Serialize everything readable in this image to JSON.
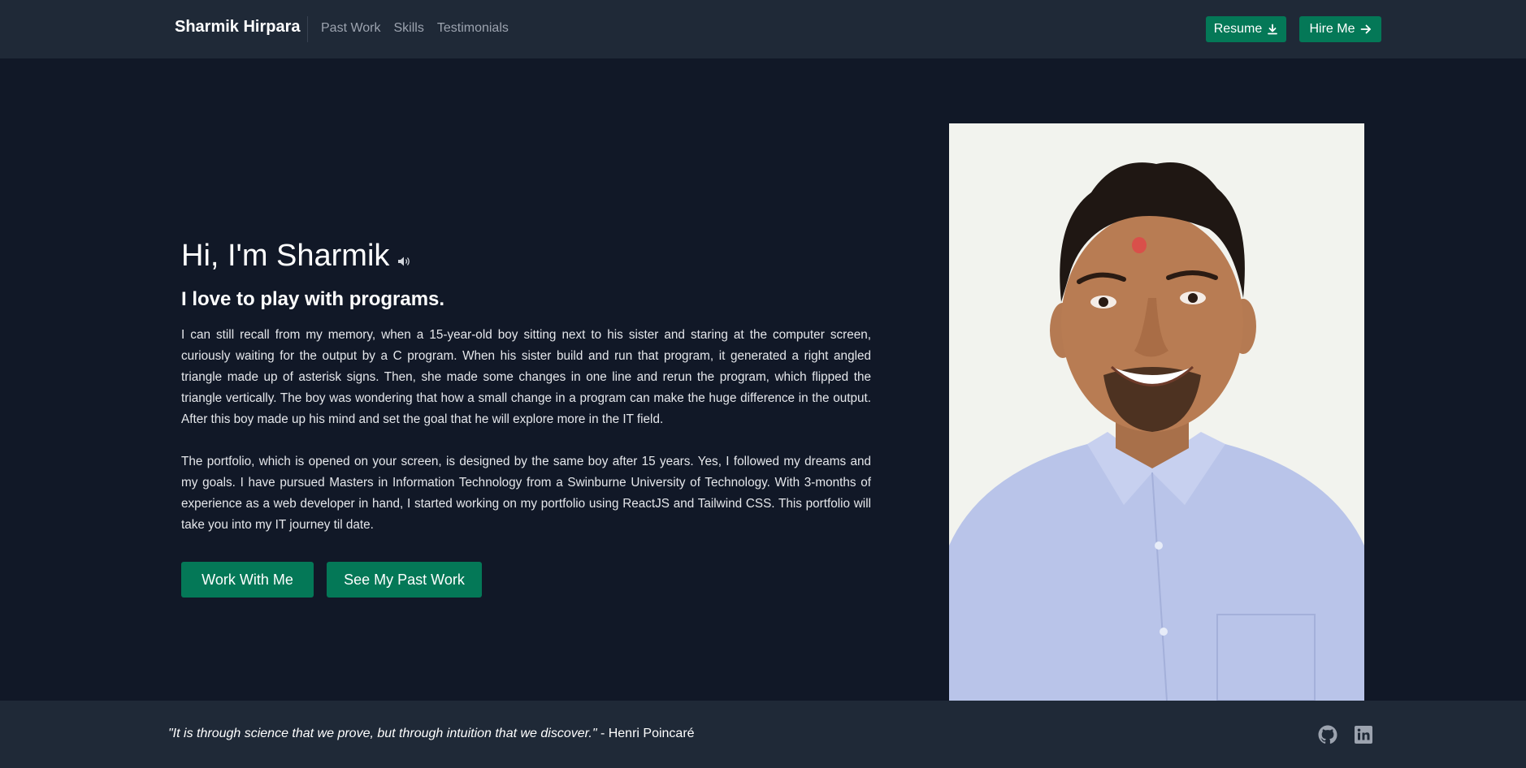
{
  "navbar": {
    "brand": "Sharmik Hirpara",
    "links": [
      "Past Work",
      "Skills",
      "Testimonials"
    ],
    "resume_label": "Resume",
    "hire_label": "Hire Me",
    "icons": {
      "resume": "download-icon",
      "hire": "arrow-right-icon"
    }
  },
  "hero": {
    "title": "Hi, I'm Sharmik",
    "title_icon": "speaker-icon",
    "subtitle": "I love to play with programs.",
    "paragraphs": [
      "I can still recall from my memory, when a 15-year-old boy sitting next to his sister and staring at the computer screen, curiously waiting for the output by a C program. When his sister build and run that program, it generated a right angled triangle made up of asterisk signs. Then, she made some changes in one line and rerun the program, which flipped the triangle vertically. The boy was wondering that how a small change in a program can make the huge difference in the output. After this boy made up his mind and set the goal that he will explore more in the IT field.",
      "The portfolio, which is opened on your screen, is designed by the same boy after 15 years. Yes, I followed my dreams and my goals. I have pursued Masters in Information Technology from a Swinburne University of Technology. With 3-months of experience as a web developer in hand, I started working on my portfolio using ReactJS and Tailwind CSS. This portfolio will take you into my IT journey til date."
    ],
    "buttons": [
      "Work With Me",
      "See My Past Work"
    ]
  },
  "footer": {
    "quote": "\"It is through science that we prove, but through intuition that we discover.\"",
    "author": " - Henri Poincaré",
    "icons": [
      "github-icon",
      "linkedin-icon"
    ]
  },
  "colors": {
    "page_bg": "#111827",
    "navbar_bg": "#1f2937",
    "accent": "#047857",
    "muted_text": "#9ca3af"
  }
}
